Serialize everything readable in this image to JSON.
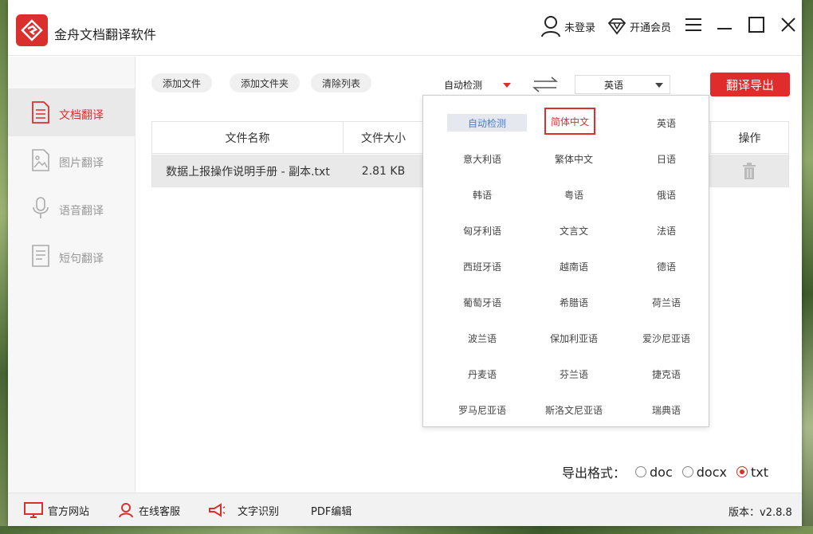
{
  "app": {
    "title": "金舟文档翻译软件",
    "accent": "#d9302d"
  },
  "header": {
    "user_label": "未登录",
    "vip_label": "开通会员"
  },
  "sidebar": {
    "items": [
      {
        "label": "文档翻译",
        "icon": "document-icon",
        "active": true
      },
      {
        "label": "图片翻译",
        "icon": "image-icon",
        "active": false
      },
      {
        "label": "语音翻译",
        "icon": "microphone-icon",
        "active": false
      },
      {
        "label": "短句翻译",
        "icon": "text-doc-icon",
        "active": false
      }
    ]
  },
  "toolbar": {
    "add_file": "添加文件",
    "add_folder": "添加文件夹",
    "clear_list": "清除列表",
    "source_lang": "自动检测",
    "target_lang": "英语",
    "export_button": "翻译导出"
  },
  "table": {
    "headers": {
      "name": "文件名称",
      "size": "文件大小",
      "action": "操作"
    },
    "rows": [
      {
        "name": "数据上报操作说明手册 - 副本.txt",
        "size": "2.81 KB"
      }
    ]
  },
  "dropdown": {
    "options": [
      [
        "自动检测",
        "简体中文",
        "英语"
      ],
      [
        "意大利语",
        "繁体中文",
        "日语"
      ],
      [
        "韩语",
        "粤语",
        "俄语"
      ],
      [
        "匈牙利语",
        "文言文",
        "法语"
      ],
      [
        "西班牙语",
        "越南语",
        "德语"
      ],
      [
        "葡萄牙语",
        "希腊语",
        "荷兰语"
      ],
      [
        "波兰语",
        "保加利亚语",
        "爱沙尼亚语"
      ],
      [
        "丹麦语",
        "芬兰语",
        "捷克语"
      ],
      [
        "罗马尼亚语",
        "斯洛文尼亚语",
        "瑞典语"
      ]
    ],
    "selected": "自动检测",
    "highlighted": "简体中文"
  },
  "export_format": {
    "label": "导出格式：",
    "options": [
      "doc",
      "docx",
      "txt"
    ],
    "selected": "txt"
  },
  "footer": {
    "website": "官方网站",
    "service": "在线客服",
    "ocr": "文字识别",
    "pdf": "PDF编辑",
    "version": "版本：v2.8.8"
  }
}
